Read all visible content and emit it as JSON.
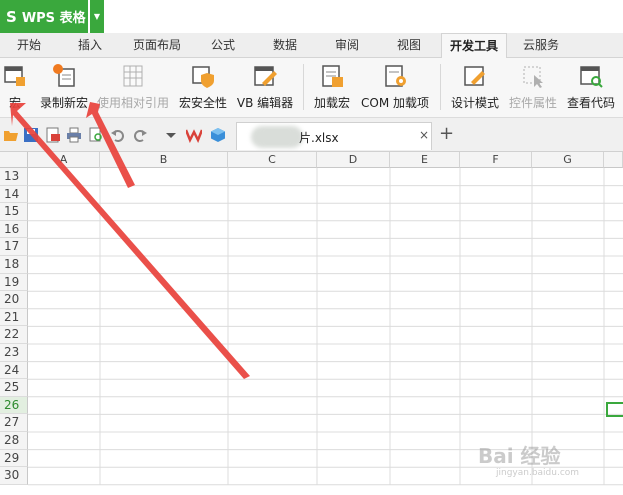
{
  "app": {
    "title": "WPS 表格",
    "logo_glyph": "S",
    "brand_color": "#3aa83d"
  },
  "menu_tabs": [
    "开始",
    "插入",
    "页面布局",
    "公式",
    "数据",
    "审阅",
    "视图",
    "开发工具",
    "云服务"
  ],
  "active_tab": "开发工具",
  "ribbon": {
    "buttons": [
      {
        "label": "宏",
        "icon": "macro-window-icon",
        "enabled": true
      },
      {
        "label": "录制新宏",
        "icon": "record-macro-icon",
        "enabled": true
      },
      {
        "label": "使用相对引用",
        "icon": "relative-reference-icon",
        "enabled": false
      },
      {
        "label": "宏安全性",
        "icon": "macro-security-icon",
        "enabled": true
      },
      {
        "label": "VB 编辑器",
        "icon": "vb-editor-icon",
        "enabled": true
      },
      {
        "label": "加载宏",
        "icon": "load-macro-icon",
        "enabled": true
      },
      {
        "label": "COM 加载项",
        "icon": "com-addin-icon",
        "enabled": true
      },
      {
        "label": "设计模式",
        "icon": "design-mode-icon",
        "enabled": true
      },
      {
        "label": "控件属性",
        "icon": "control-properties-icon",
        "enabled": false
      },
      {
        "label": "查看代码",
        "icon": "view-code-icon",
        "enabled": true
      }
    ]
  },
  "document_tab": {
    "name": "片.xlsx",
    "close_glyph": "×",
    "add_glyph": "+"
  },
  "columns": [
    "A",
    "B",
    "C",
    "D",
    "E",
    "F",
    "G"
  ],
  "rows": [
    "13",
    "14",
    "15",
    "16",
    "17",
    "18",
    "19",
    "20",
    "21",
    "22",
    "23",
    "24",
    "25",
    "26",
    "27",
    "28",
    "29",
    "30"
  ],
  "active_row": "26",
  "watermark": {
    "main": "Bai 经验",
    "sub": "jingyan.baidu.com"
  },
  "annotation_color": "#e8413b"
}
